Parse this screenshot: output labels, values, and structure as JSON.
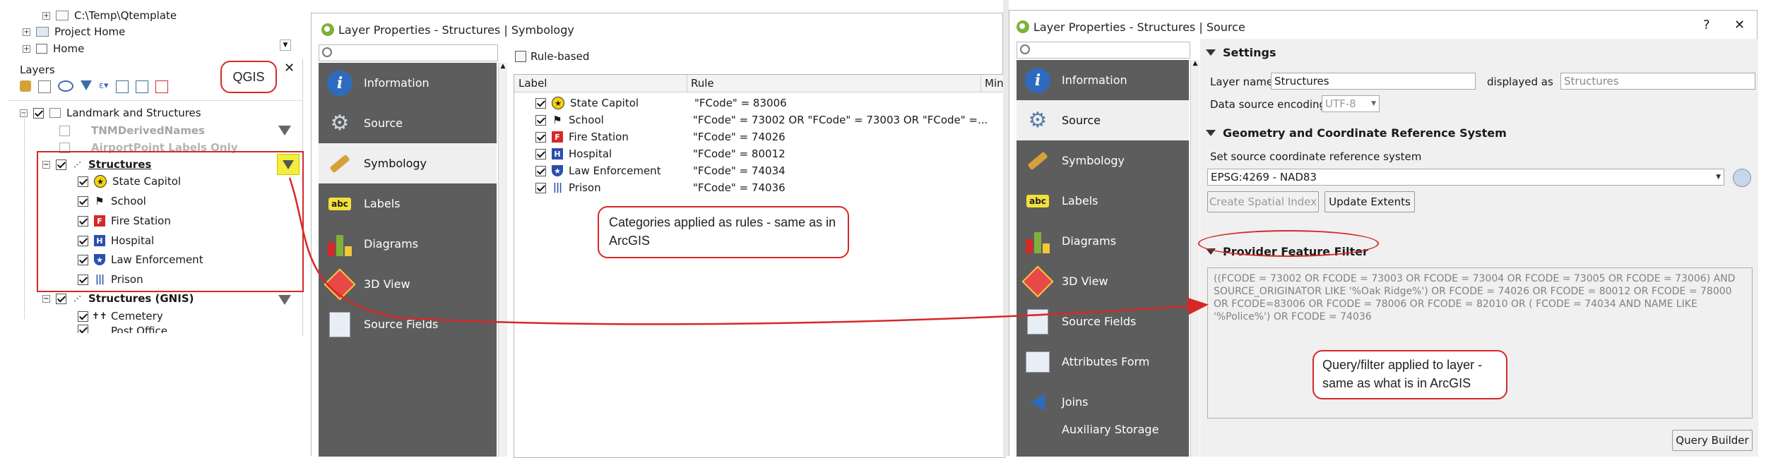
{
  "browser": {
    "items": [
      {
        "label": "C:\\Temp\\Qtemplate"
      },
      {
        "label": "Project Home"
      },
      {
        "label": "Home"
      }
    ]
  },
  "layers_panel": {
    "title": "Layers",
    "qgis_label": "QGIS",
    "groups": [
      {
        "name": "Landmark and Structures"
      },
      {
        "name": "TNMDerivedNames"
      },
      {
        "name": "AirportPoint Labels Only"
      },
      {
        "name": "Structures"
      },
      {
        "name": "Structures (GNIS)"
      }
    ],
    "categories": [
      "State Capitol",
      "School",
      "Fire Station",
      "Hospital",
      "Law Enforcement",
      "Prison"
    ],
    "gnis_items": [
      "Cemetery",
      "Post Office"
    ]
  },
  "symbology_window": {
    "title": "Layer Properties - Structures | Symbology",
    "renderer": "Rule-based",
    "columns": [
      "Label",
      "Rule",
      "Min."
    ],
    "nav": [
      "Information",
      "Source",
      "Symbology",
      "Labels",
      "Diagrams",
      "3D View",
      "Source Fields"
    ],
    "rules": [
      {
        "label": "State Capitol",
        "rule": "\"FCode\" = 83006"
      },
      {
        "label": "School",
        "rule": "\"FCode\" = 73002 OR \"FCode\" = 73003 OR \"FCode\" =..."
      },
      {
        "label": "Fire Station",
        "rule": "\"FCode\" = 74026"
      },
      {
        "label": "Hospital",
        "rule": "\"FCode\" = 80012"
      },
      {
        "label": "Law Enforcement",
        "rule": "\"FCode\" = 74034"
      },
      {
        "label": "Prison",
        "rule": "\"FCode\" = 74036"
      }
    ],
    "callout": "Categories applied as rules - same as in ArcGIS"
  },
  "source_window": {
    "title": "Layer Properties - Structures | Source",
    "help": "?",
    "close": "✕",
    "nav": [
      "Information",
      "Source",
      "Symbology",
      "Labels",
      "Diagrams",
      "3D View",
      "Source Fields",
      "Attributes Form",
      "Joins",
      "Auxiliary Storage"
    ],
    "settings": {
      "header": "Settings",
      "layer_name_label": "Layer name",
      "layer_name_value": "Structures",
      "displayed_as_label": "displayed as",
      "displayed_as_value": "Structures",
      "encoding_label": "Data source encoding",
      "encoding_value": "UTF-8"
    },
    "crs": {
      "header": "Geometry and Coordinate Reference System",
      "set_label": "Set source coordinate reference system",
      "value": "EPSG:4269 - NAD83",
      "create_index_button": "Create Spatial Index",
      "update_extents_button": "Update Extents"
    },
    "filter": {
      "header": "Provider Feature Filter",
      "text": "((FCODE = 73002 OR FCODE = 73003 OR FCODE = 73004 OR FCODE = 73005 OR FCODE = 73006) AND SOURCE_ORIGINATOR LIKE '%Oak Ridge%') OR FCODE = 74026 OR FCODE = 80012 OR FCODE = 78000 OR FCODE=83006 OR FCODE = 78006 OR FCODE = 82010 OR ( FCODE = 74034 AND NAME LIKE '%Police%') OR FCODE = 74036",
      "query_builder_button": "Query Builder",
      "callout": "Query/filter applied to layer - same as what is in ArcGIS"
    }
  },
  "colors": {
    "sidebar": "#5d5d5d",
    "annotation_red": "#d62828",
    "highlight_yellow": "#f3ee3a"
  }
}
